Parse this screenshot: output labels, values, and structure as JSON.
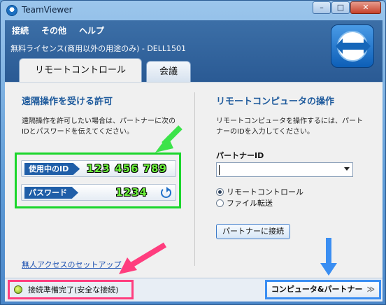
{
  "window": {
    "title": "TeamViewer",
    "controls": {
      "minimize": "–",
      "maximize": "□",
      "close": "✕"
    }
  },
  "menubar": {
    "items": [
      "接続",
      "その他",
      "ヘルプ"
    ]
  },
  "license_text": "無料ライセンス(商用以外の用途のみ) - DELL1501",
  "tabs": [
    {
      "label": "リモートコントロール",
      "active": true
    },
    {
      "label": "会議",
      "active": false
    }
  ],
  "allow_remote": {
    "title": "遠隔操作を受ける許可",
    "description": "遠隔操作を許可したい場合は、パートナーに次のIDとパスワードを伝えてください。",
    "id_label": "使用中のID",
    "id_value": "123 456 789",
    "password_label": "パスワード",
    "password_value": "1234",
    "unattended_link": "無人アクセスのセットアップ"
  },
  "control_remote": {
    "title": "リモートコンピュータの操作",
    "description": "リモートコンピュータを操作するには、パートナーのIDを入力してください。",
    "partner_id_label": "パートナーID",
    "partner_id_value": "",
    "options": [
      {
        "label": "リモートコントロール",
        "selected": true
      },
      {
        "label": "ファイル転送",
        "selected": false
      }
    ],
    "connect_button": "パートナーに接続"
  },
  "statusbar": {
    "status_text": "接続準備完了(安全な接続)",
    "computers_button": "コンピュータ&パートナー",
    "computers_chevron": "≫"
  },
  "colors": {
    "highlight_green": "#1bd62b",
    "highlight_pink": "#ff3d7e",
    "highlight_blue": "#3a8ef2",
    "accent": "#1e5a9c"
  }
}
